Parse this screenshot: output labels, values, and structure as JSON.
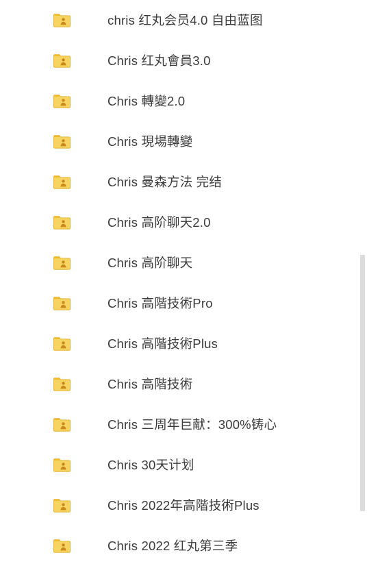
{
  "window": {
    "background_color": "#ffffff",
    "text_color": "#3b3b3b"
  },
  "icons": {
    "folder_shared": {
      "name": "shared-folder-icon",
      "body_color": "#f7d461",
      "tab_color": "#f0b92a",
      "edge_color": "#e0a81f",
      "person_color": "#c8881a"
    }
  },
  "scrollbar": {
    "name": "vertical-scrollbar",
    "thumb_color": "#dcdcdc",
    "orientation": "vertical"
  },
  "file_list": {
    "name": "folder-list",
    "items": [
      {
        "label": "chris 红丸会员4.0 自由蓝图",
        "icon": "shared-folder-icon"
      },
      {
        "label": "Chris 红丸會員3.0",
        "icon": "shared-folder-icon"
      },
      {
        "label": "Chris 轉變2.0",
        "icon": "shared-folder-icon"
      },
      {
        "label": "Chris 現場轉變",
        "icon": "shared-folder-icon"
      },
      {
        "label": "Chris 曼森方法 完结",
        "icon": "shared-folder-icon"
      },
      {
        "label": "Chris 高阶聊天2.0",
        "icon": "shared-folder-icon"
      },
      {
        "label": "Chris 高阶聊天",
        "icon": "shared-folder-icon"
      },
      {
        "label": "Chris 高階技術Pro",
        "icon": "shared-folder-icon"
      },
      {
        "label": "Chris 高階技術Plus",
        "icon": "shared-folder-icon"
      },
      {
        "label": "Chris 高階技術",
        "icon": "shared-folder-icon"
      },
      {
        "label": "Chris 三周年巨献：300%铸心",
        "icon": "shared-folder-icon"
      },
      {
        "label": "Chris 30天计划",
        "icon": "shared-folder-icon"
      },
      {
        "label": "Chris 2022年高階技術Plus",
        "icon": "shared-folder-icon"
      },
      {
        "label": "Chris 2022  红丸第三季",
        "icon": "shared-folder-icon"
      }
    ]
  }
}
